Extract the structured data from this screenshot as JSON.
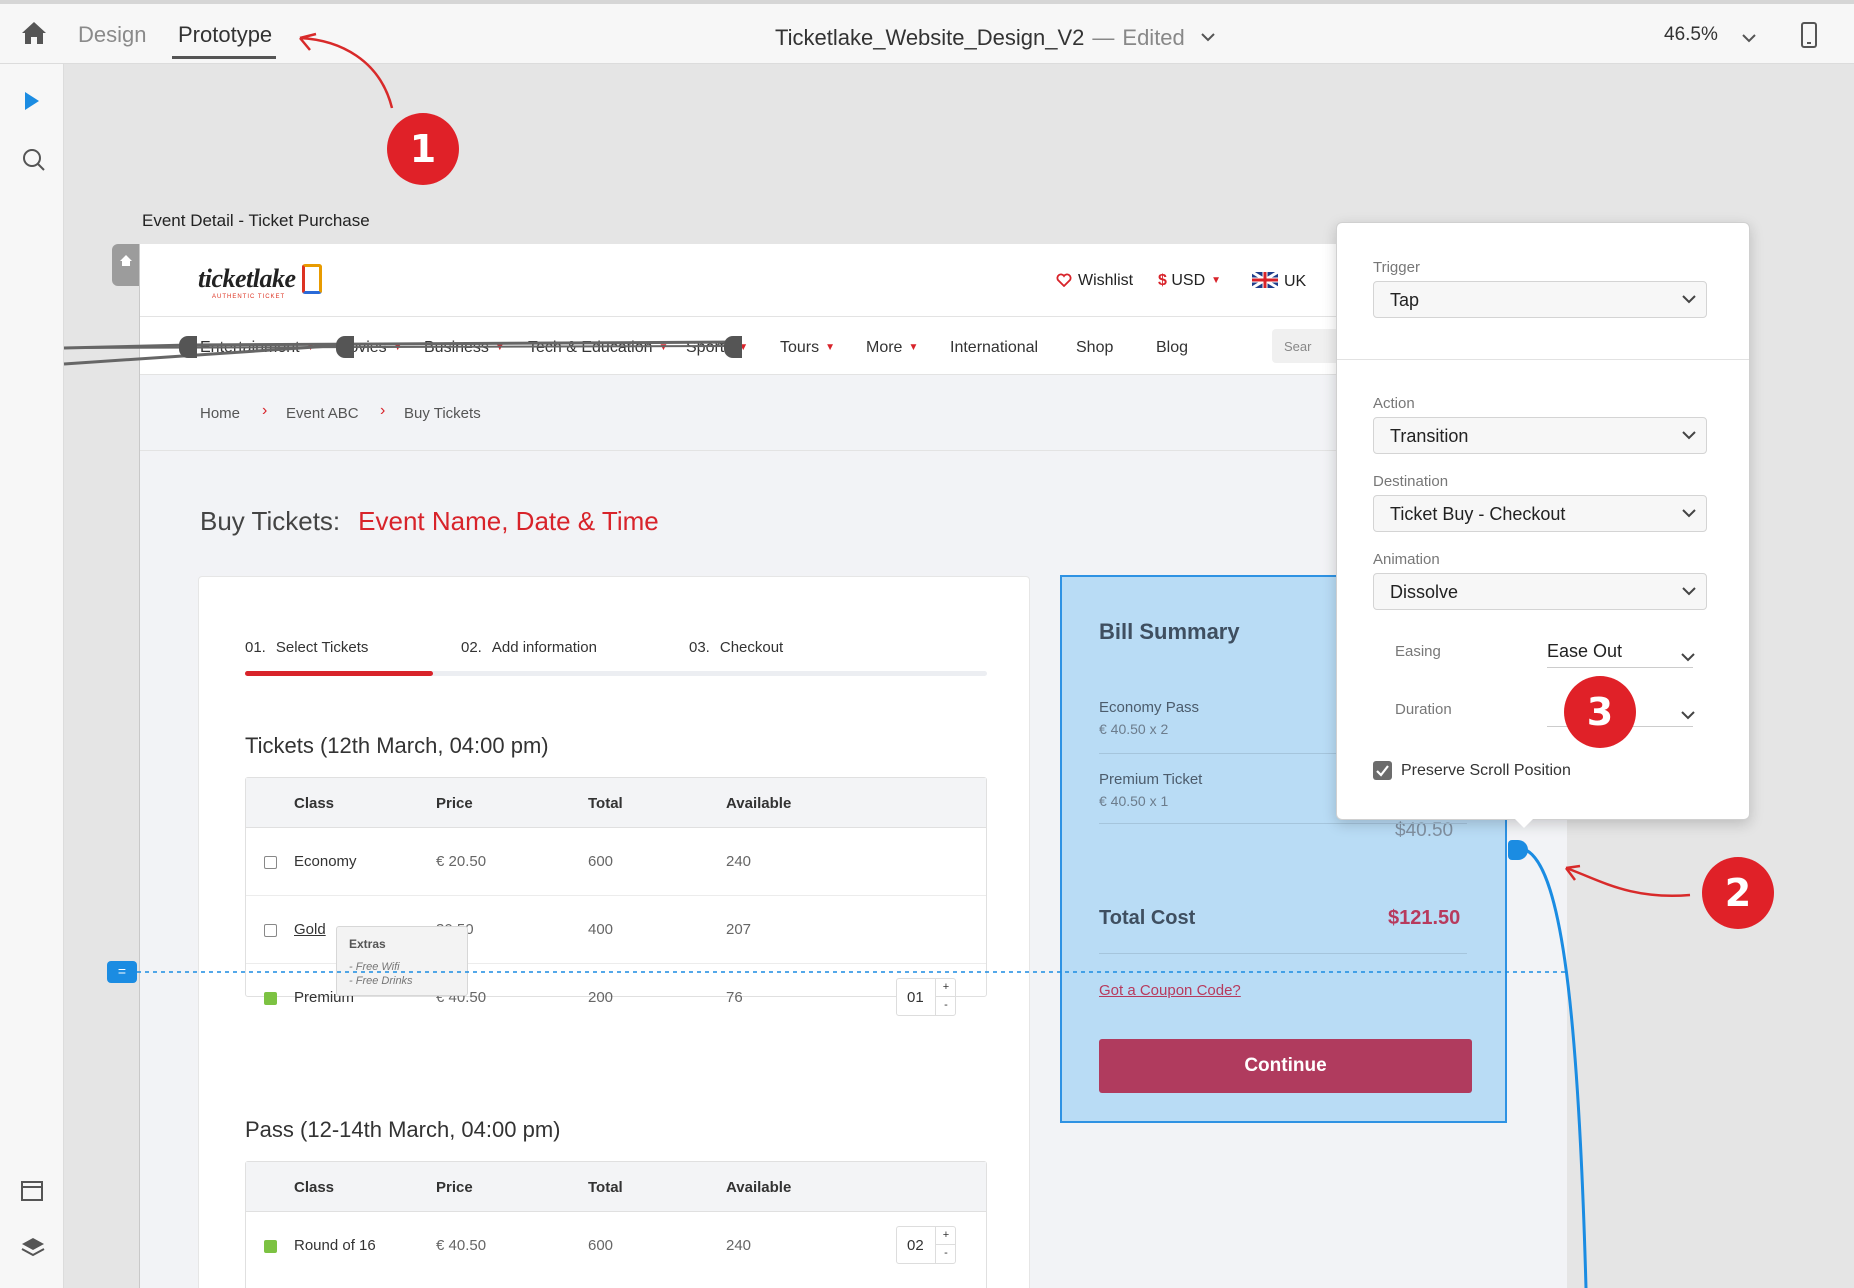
{
  "app": {
    "tabs": [
      {
        "label": "Design"
      },
      {
        "label": "Prototype"
      }
    ],
    "doc_title": "Ticketlake_Website_Design_V2",
    "doc_sep": "—",
    "doc_status": "Edited",
    "zoom": "46.5%",
    "artboard_label": "Event Detail - Ticket Purchase"
  },
  "site": {
    "logo": "ticketlake",
    "logo_sub": "AUTHENTIC TICKET",
    "header": {
      "wishlist": "Wishlist",
      "currency": "$ USD",
      "region": "UK"
    },
    "nav": [
      {
        "label": "Entertainment"
      },
      {
        "label": "Movies"
      },
      {
        "label": "Business"
      },
      {
        "label": "Tech & Education"
      },
      {
        "label": "Sports"
      },
      {
        "label": "Tours"
      },
      {
        "label": "More"
      },
      {
        "label": "International"
      },
      {
        "label": "Shop"
      },
      {
        "label": "Blog"
      }
    ],
    "search_placeholder": "Sear",
    "breadcrumb": [
      "Home",
      "Event ABC",
      "Buy Tickets"
    ],
    "buy_title": "Buy Tickets:",
    "buy_subtitle": "Event Name, Date & Time",
    "steps": [
      {
        "num": "01.",
        "label": "Select Tickets"
      },
      {
        "num": "02.",
        "label": "Add information"
      },
      {
        "num": "03.",
        "label": "Checkout"
      }
    ],
    "tickets": {
      "title": "Tickets (12th March, 04:00 pm)",
      "headers": [
        "Class",
        "Price",
        "Total",
        "Available"
      ],
      "rows": [
        {
          "name": "Economy",
          "price": "€ 20.50",
          "total": "600",
          "available": "240"
        },
        {
          "name": "Gold",
          "price": "30.50",
          "total": "400",
          "available": "207"
        },
        {
          "name": "Premium",
          "price": "€ 40.50",
          "total": "200",
          "available": "76",
          "qty": "01"
        }
      ],
      "extras": {
        "title": "Extras",
        "lines": [
          "- Free Wifi",
          "- Free Drinks"
        ]
      }
    },
    "pass": {
      "title": "Pass (12-14th March, 04:00 pm)",
      "headers": [
        "Class",
        "Price",
        "Total",
        "Available"
      ],
      "rows": [
        {
          "name": "Round of 16",
          "price": "€ 40.50",
          "total": "600",
          "available": "240",
          "qty": "02"
        }
      ]
    },
    "qty_plus": "+",
    "qty_minus": "-",
    "bill": {
      "title": "Bill Summary",
      "items": [
        {
          "name": "Economy Pass",
          "sub": "€ 40.50 x 2"
        },
        {
          "name": "Premium Ticket",
          "sub": "€ 40.50 x 1",
          "price": "$40.50"
        }
      ],
      "total_label": "Total Cost",
      "total_value": "$121.50",
      "coupon": "Got a Coupon Code?",
      "continue": "Continue"
    }
  },
  "panel": {
    "trigger_label": "Trigger",
    "trigger_value": "Tap",
    "action_label": "Action",
    "action_value": "Transition",
    "destination_label": "Destination",
    "destination_value": "Ticket Buy - Checkout",
    "animation_label": "Animation",
    "animation_value": "Dissolve",
    "easing_label": "Easing",
    "easing_value": "Ease Out",
    "duration_label": "Duration",
    "preserve_label": "Preserve Scroll Position",
    "preserve_checked": true
  },
  "annotations": [
    "1",
    "2",
    "3"
  ],
  "colors": {
    "accent_red": "#d8232a",
    "selection_blue": "#2e92e3",
    "badge_red": "#e02128",
    "continue": "#b03b5e"
  }
}
